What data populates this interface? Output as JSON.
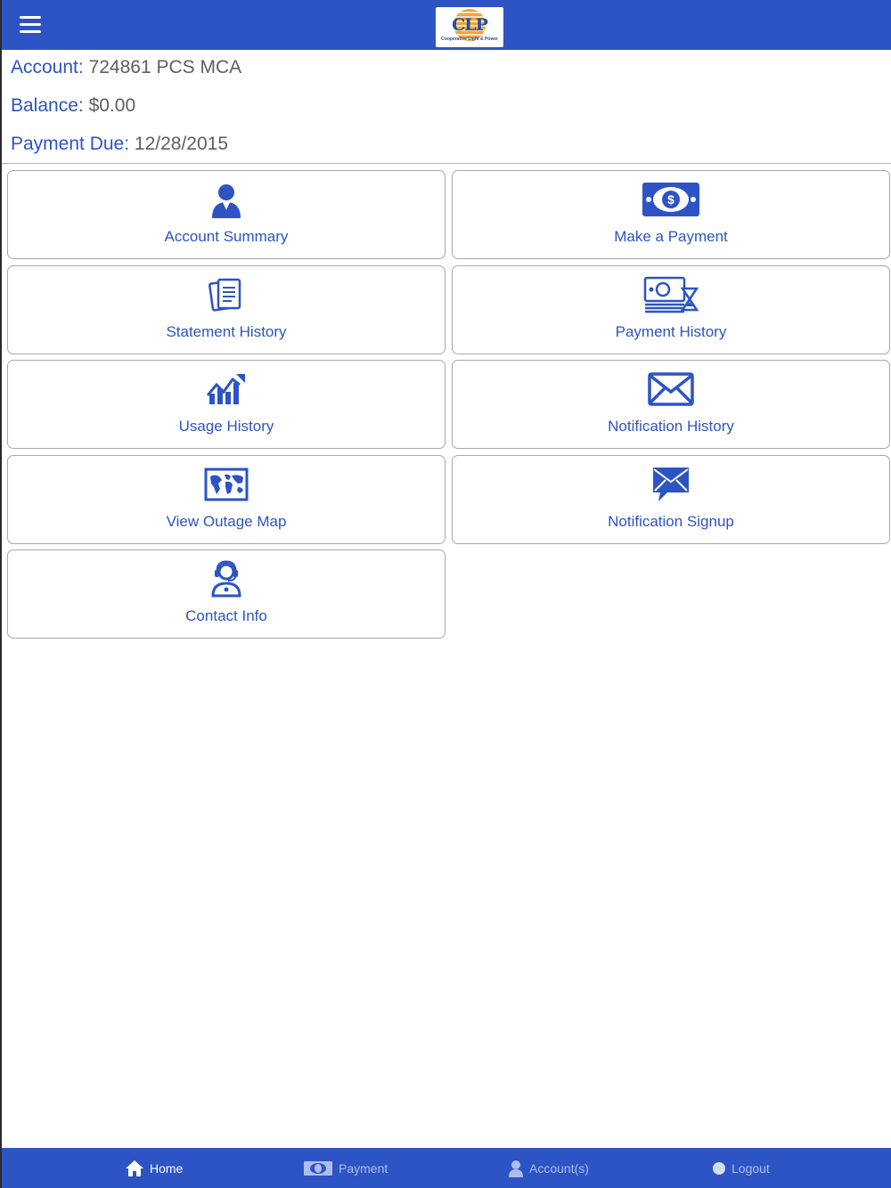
{
  "header": {
    "logo_text": "CLP",
    "logo_subtitle": "Cooperative Light & Power"
  },
  "account": {
    "account_label": "Account:",
    "account_value": "724861 PCS MCA",
    "balance_label": "Balance:",
    "balance_value": "$0.00",
    "due_label": "Payment Due:",
    "due_value": "12/28/2015"
  },
  "tiles": [
    {
      "label": "Account Summary",
      "icon": "person-icon"
    },
    {
      "label": "Make a Payment",
      "icon": "money-icon"
    },
    {
      "label": "Statement History",
      "icon": "documents-icon"
    },
    {
      "label": "Payment History",
      "icon": "money-hourglass-icon"
    },
    {
      "label": "Usage History",
      "icon": "chart-trend-icon"
    },
    {
      "label": "Notification History",
      "icon": "envelope-icon"
    },
    {
      "label": "View Outage Map",
      "icon": "map-icon"
    },
    {
      "label": "Notification Signup",
      "icon": "chat-envelope-icon"
    },
    {
      "label": "Contact Info",
      "icon": "headset-person-icon"
    }
  ],
  "bottom_nav": [
    {
      "label": "Home",
      "icon": "home-icon",
      "active": true
    },
    {
      "label": "Payment",
      "icon": "money-icon",
      "active": false
    },
    {
      "label": "Account(s)",
      "icon": "person-icon",
      "active": false
    },
    {
      "label": "Logout",
      "icon": "circle-icon",
      "active": false
    }
  ],
  "colors": {
    "brand_blue": "#2d54c4",
    "text_gray": "#5f5f5f",
    "inactive_nav": "#aebde9"
  }
}
